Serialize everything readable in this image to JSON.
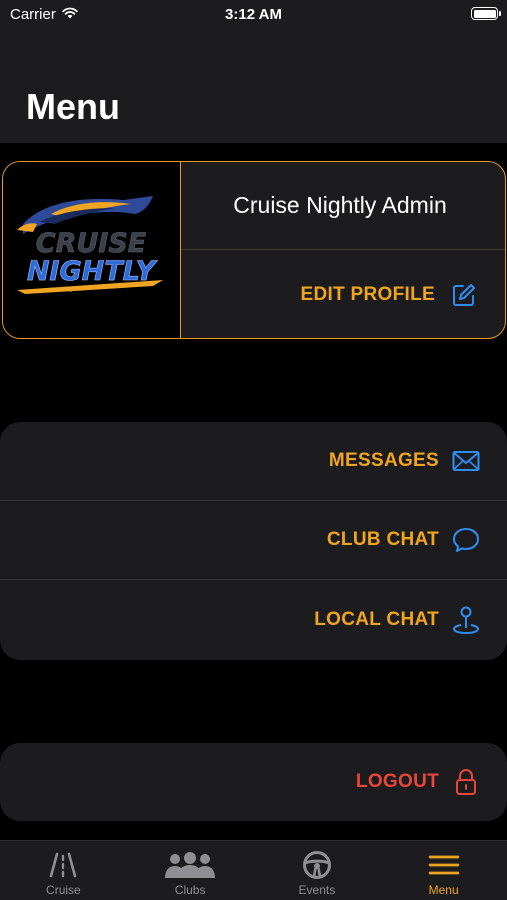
{
  "status_bar": {
    "carrier": "Carrier",
    "time": "3:12 AM"
  },
  "header": {
    "title": "Menu"
  },
  "profile": {
    "name": "Cruise Nightly Admin",
    "edit_label": "EDIT PROFILE",
    "logo": {
      "line1": "CRUISE",
      "line2": "NIGHTLY"
    }
  },
  "menu": {
    "items": [
      {
        "label": "MESSAGES",
        "icon": "envelope-icon"
      },
      {
        "label": "CLUB CHAT",
        "icon": "chat-bubble-icon"
      },
      {
        "label": "LOCAL CHAT",
        "icon": "location-pin-icon"
      }
    ],
    "logout_label": "LOGOUT"
  },
  "tab_bar": {
    "tabs": [
      {
        "label": "Cruise",
        "icon": "road-icon"
      },
      {
        "label": "Clubs",
        "icon": "people-icon"
      },
      {
        "label": "Events",
        "icon": "steering-wheel-icon"
      },
      {
        "label": "Menu",
        "icon": "hamburger-icon",
        "active": true
      }
    ]
  },
  "colors": {
    "accent": "#f0a522",
    "icon_blue": "#2f8ef5",
    "danger": "#e8453b",
    "card_bg": "#1c1c1e",
    "background": "#000000"
  }
}
